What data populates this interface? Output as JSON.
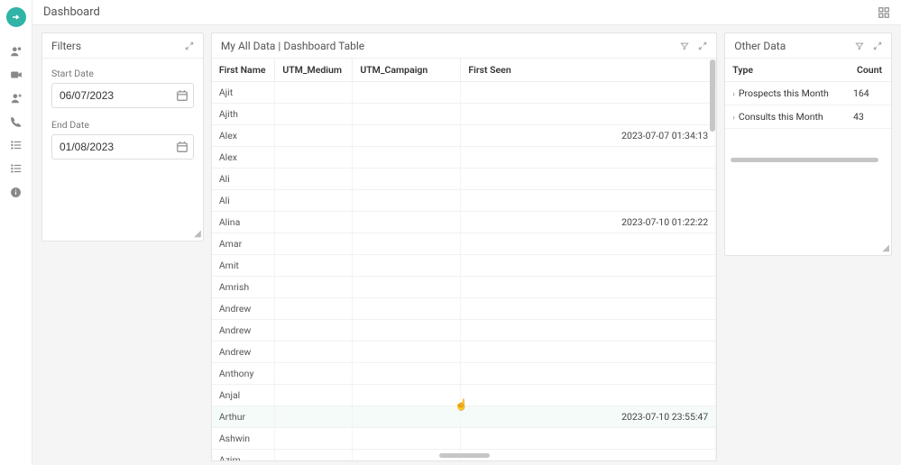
{
  "header": {
    "title": "Dashboard"
  },
  "filters": {
    "title": "Filters",
    "start_label": "Start Date",
    "start_value": "06/07/2023",
    "end_label": "End Date",
    "end_value": "01/08/2023"
  },
  "main": {
    "title": "My All Data | Dashboard Table",
    "columns": {
      "c1": "First Name",
      "c2": "UTM_Medium",
      "c3": "UTM_Campaign",
      "c4": "First Seen"
    },
    "rows": [
      {
        "first_name": "Ajit",
        "utm_medium": "",
        "utm_campaign": "",
        "first_seen": ""
      },
      {
        "first_name": "Ajith",
        "utm_medium": "",
        "utm_campaign": "",
        "first_seen": ""
      },
      {
        "first_name": "Alex",
        "utm_medium": "",
        "utm_campaign": "",
        "first_seen": "2023-07-07 01:34:13"
      },
      {
        "first_name": "Alex",
        "utm_medium": "",
        "utm_campaign": "",
        "first_seen": ""
      },
      {
        "first_name": "Ali",
        "utm_medium": "",
        "utm_campaign": "",
        "first_seen": ""
      },
      {
        "first_name": "Ali",
        "utm_medium": "",
        "utm_campaign": "",
        "first_seen": ""
      },
      {
        "first_name": "Alina",
        "utm_medium": "",
        "utm_campaign": "",
        "first_seen": "2023-07-10 01:22:22"
      },
      {
        "first_name": "Amar",
        "utm_medium": "",
        "utm_campaign": "",
        "first_seen": ""
      },
      {
        "first_name": "Amit",
        "utm_medium": "",
        "utm_campaign": "",
        "first_seen": ""
      },
      {
        "first_name": "Amrish",
        "utm_medium": "",
        "utm_campaign": "",
        "first_seen": ""
      },
      {
        "first_name": "Andrew",
        "utm_medium": "",
        "utm_campaign": "",
        "first_seen": ""
      },
      {
        "first_name": "Andrew",
        "utm_medium": "",
        "utm_campaign": "",
        "first_seen": ""
      },
      {
        "first_name": "Andrew",
        "utm_medium": "",
        "utm_campaign": "",
        "first_seen": ""
      },
      {
        "first_name": "Anthony",
        "utm_medium": "",
        "utm_campaign": "",
        "first_seen": ""
      },
      {
        "first_name": "Anjal",
        "utm_medium": "",
        "utm_campaign": "",
        "first_seen": ""
      },
      {
        "first_name": "Arthur",
        "utm_medium": "",
        "utm_campaign": "",
        "first_seen": "2023-07-10 23:55:47"
      },
      {
        "first_name": "Ashwin",
        "utm_medium": "",
        "utm_campaign": "",
        "first_seen": ""
      },
      {
        "first_name": "Azim",
        "utm_medium": "",
        "utm_campaign": "",
        "first_seen": ""
      }
    ]
  },
  "other": {
    "title": "Other Data",
    "columns": {
      "c1": "Type",
      "c2": "Count"
    },
    "rows": [
      {
        "type": "Prospects this Month",
        "count": "164"
      },
      {
        "type": "Consults this Month",
        "count": "43"
      }
    ]
  }
}
